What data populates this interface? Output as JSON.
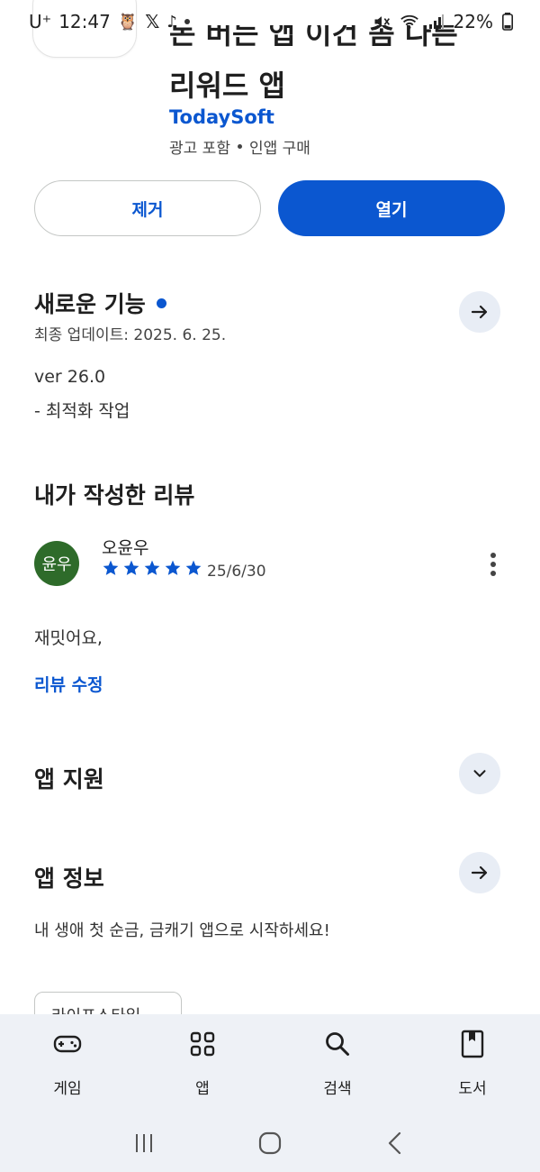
{
  "status_bar": {
    "carrier": "U⁺",
    "time": "12:47",
    "battery": "22%"
  },
  "app": {
    "title_line_partial": "돈 버는 앱 이건 좀 다른",
    "title": "리워드 앱",
    "developer": "TodaySoft",
    "meta_ads": "광고 포함",
    "meta_iap": "인앱 구매"
  },
  "buttons": {
    "remove": "제거",
    "open": "열기"
  },
  "whats_new": {
    "title": "새로운 기능",
    "updated": "최종 업데이트: 2025. 6. 25.",
    "version": "ver 26.0",
    "notes": "- 최적화 작업"
  },
  "my_review": {
    "title": "내가 작성한 리뷰",
    "avatar_text": "윤우",
    "reviewer": "오윤우",
    "rating": 5,
    "date": "25/6/30",
    "text": "재밋어요,",
    "edit": "리뷰 수정"
  },
  "app_support": {
    "title": "앱 지원"
  },
  "app_info": {
    "title": "앱 정보",
    "description": "내 생애 첫 순금, 금캐기 앱으로 시작하세요!",
    "chip_partial": "라이프스타일"
  },
  "bottom_nav": {
    "games": "게임",
    "apps": "앱",
    "search": "검색",
    "books": "도서"
  },
  "colors": {
    "accent": "#0b57d0",
    "avatar": "#2e6b2a",
    "nav_bg": "#eef1f6"
  }
}
